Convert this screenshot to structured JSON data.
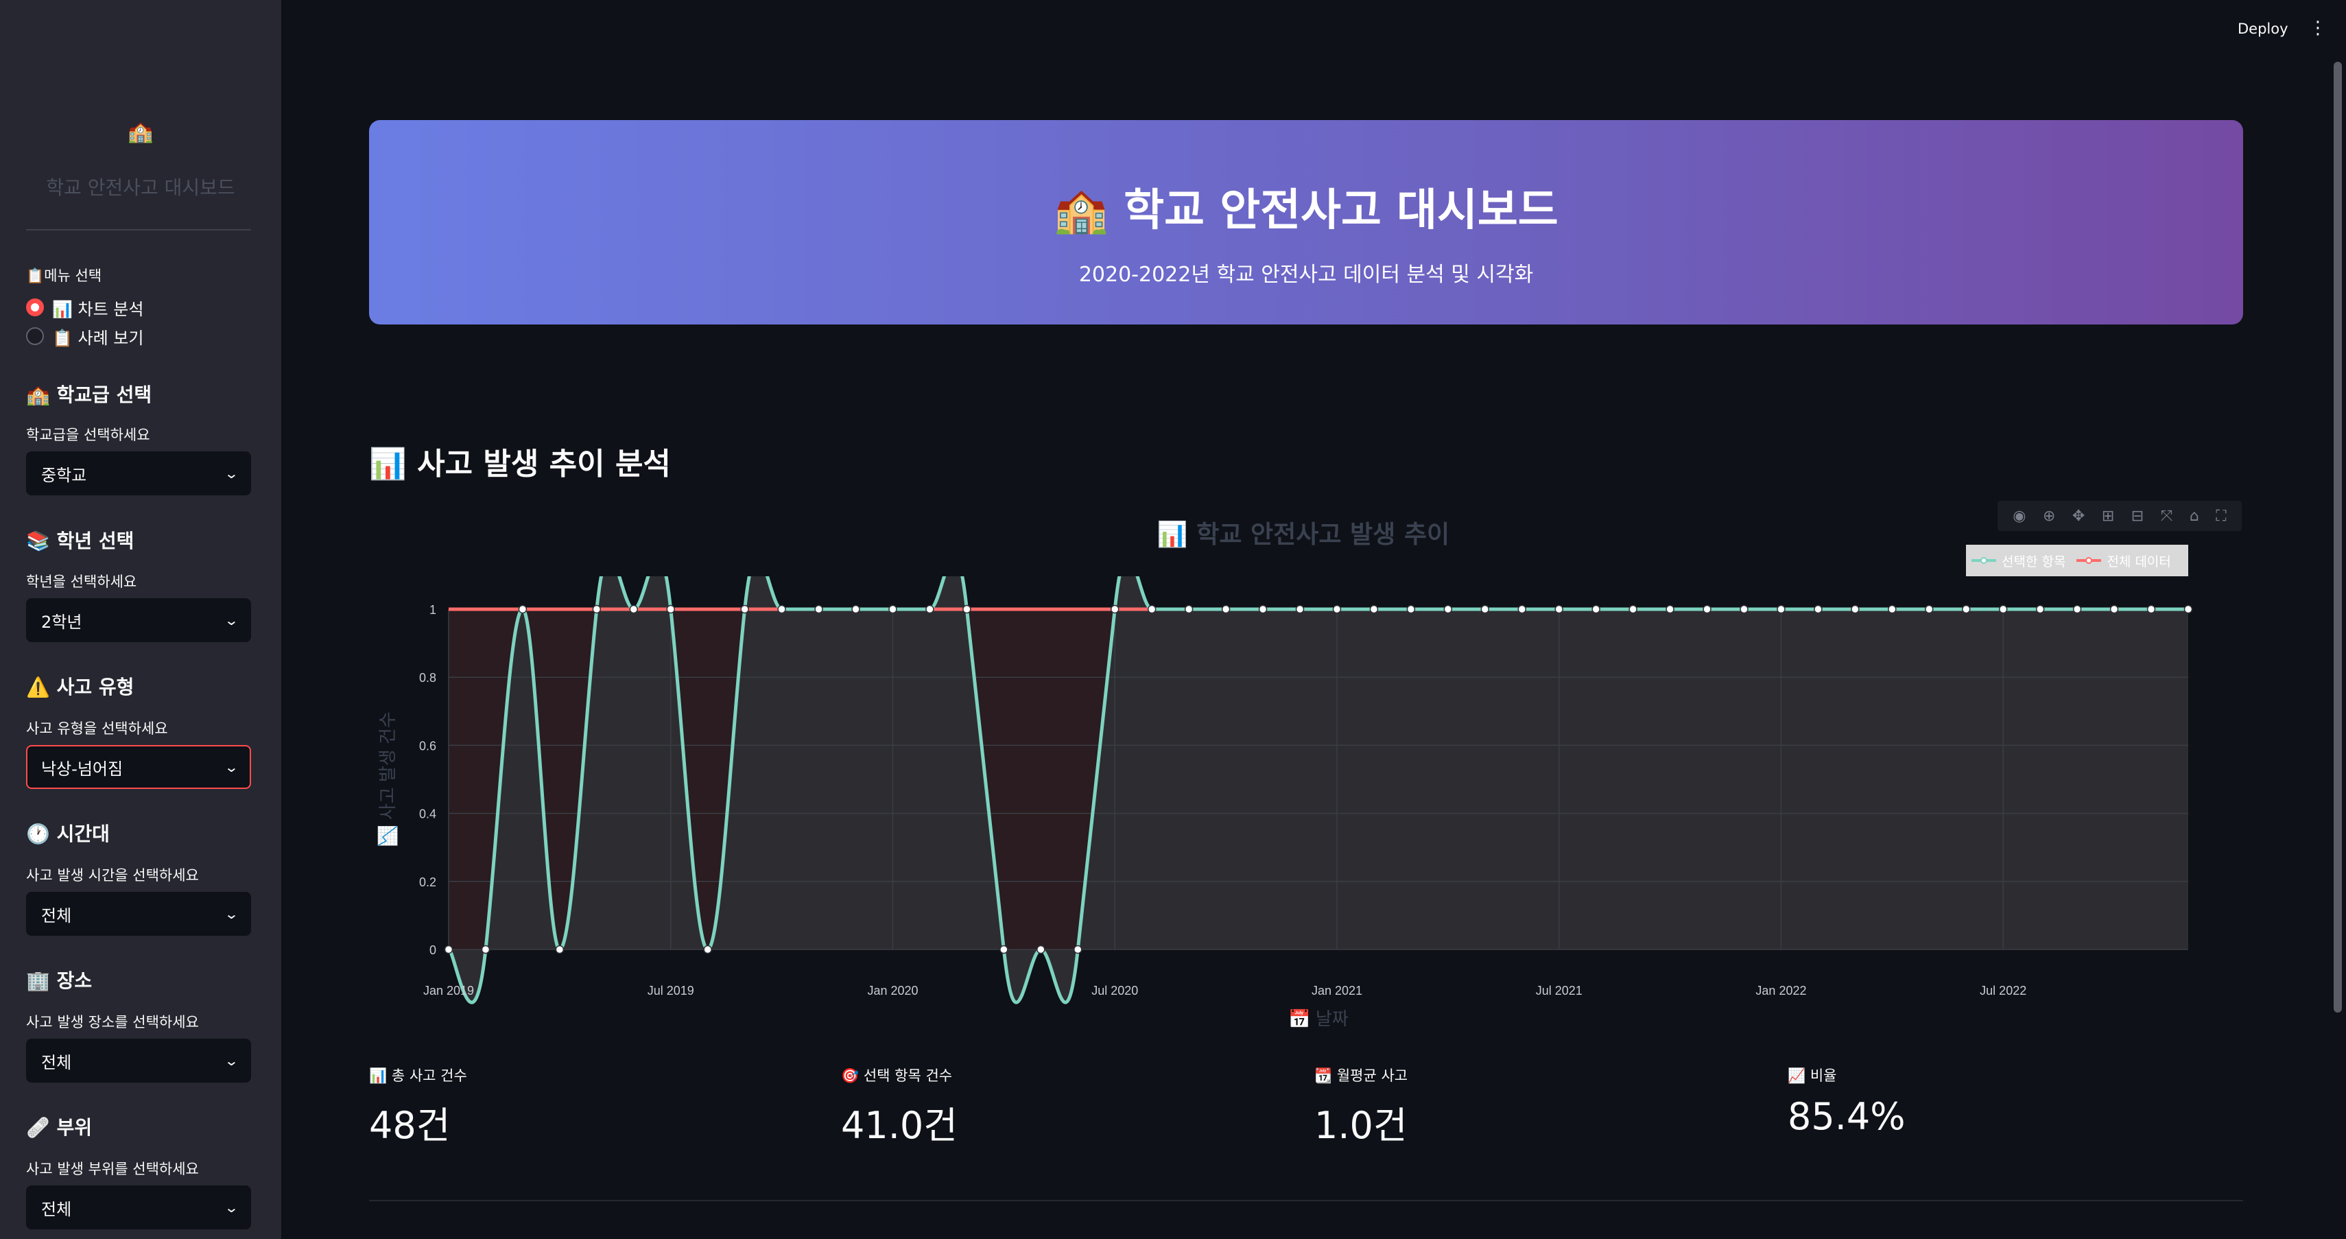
{
  "sidebar": {
    "logo": "🏫",
    "title": "학교 안전사고 대시보드",
    "menu_label": "📋메뉴 선택",
    "menu_options": [
      {
        "label": "📊 차트 분석",
        "selected": true
      },
      {
        "label": "📋 사례 보기",
        "selected": false
      }
    ],
    "filters": [
      {
        "heading": "🏫 학교급 선택",
        "label": "학교급을 선택하세요",
        "value": "중학교"
      },
      {
        "heading": "📚 학년 선택",
        "label": "학년을 선택하세요",
        "value": "2학년"
      },
      {
        "heading": "⚠️ 사고 유형",
        "label": "사고 유형을 선택하세요",
        "value": "낙상-넘어짐"
      },
      {
        "heading": "🕐 시간대",
        "label": "사고 발생 시간을 선택하세요",
        "value": "전체"
      },
      {
        "heading": "🏢 장소",
        "label": "사고 발생 장소를 선택하세요",
        "value": "전체"
      },
      {
        "heading": "🩹 부위",
        "label": "사고 발생 부위를 선택하세요",
        "value": "전체"
      }
    ]
  },
  "header": {
    "deploy_label": "Deploy",
    "more_icon": "kebab-menu-icon"
  },
  "hero": {
    "title": "🏫 학교 안전사고 대시보드",
    "subtitle": "2020-2022년 학교 안전사고 데이터 분석 및 시각화"
  },
  "section": {
    "title": "📊 사고 발생 추이 분석"
  },
  "modebar_icons": [
    "camera-icon",
    "zoom-icon",
    "pan-icon",
    "zoom-in-icon",
    "zoom-out-icon",
    "autoscale-icon",
    "home-icon",
    "fullscreen-icon"
  ],
  "chart_data": {
    "type": "line",
    "title": "📊 학교 안전사고 발생 추이",
    "xlabel": "📅 날짜",
    "ylabel": "📉 사고 발생 건수",
    "ylim": [
      0,
      1
    ],
    "yticks": [
      "0",
      "0.2",
      "0.4",
      "0.6",
      "0.8",
      "1"
    ],
    "xticks": [
      "Jan 2019",
      "Jul 2019",
      "Jan 2020",
      "Jul 2020",
      "Jan 2021",
      "Jul 2021",
      "Jan 2022",
      "Jul 2022"
    ],
    "x": [
      "2019-01",
      "2019-02",
      "2019-03",
      "2019-04",
      "2019-05",
      "2019-06",
      "2019-07",
      "2019-08",
      "2019-09",
      "2019-10",
      "2019-11",
      "2019-12",
      "2020-01",
      "2020-02",
      "2020-03",
      "2020-04",
      "2020-05",
      "2020-06",
      "2020-07",
      "2020-08",
      "2020-09",
      "2020-10",
      "2020-11",
      "2020-12",
      "2021-01",
      "2021-02",
      "2021-03",
      "2021-04",
      "2021-05",
      "2021-06",
      "2021-07",
      "2021-08",
      "2021-09",
      "2021-10",
      "2021-11",
      "2021-12",
      "2022-01",
      "2022-02",
      "2022-03",
      "2022-04",
      "2022-05",
      "2022-06",
      "2022-07",
      "2022-08",
      "2022-09",
      "2022-10",
      "2022-11",
      "2022-12"
    ],
    "series": [
      {
        "name": "선택한 항목",
        "color": "#7dd3c0",
        "values": [
          0,
          0,
          1,
          0,
          1,
          1,
          1,
          0,
          1,
          1,
          1,
          1,
          1,
          1,
          1,
          0,
          0,
          0,
          1,
          1,
          1,
          1,
          1,
          1,
          1,
          1,
          1,
          1,
          1,
          1,
          1,
          1,
          1,
          1,
          1,
          1,
          1,
          1,
          1,
          1,
          1,
          1,
          1,
          1,
          1,
          1,
          1,
          1
        ]
      },
      {
        "name": "전체 데이터",
        "color": "#ff6b6b",
        "values": [
          1,
          1,
          1,
          1,
          1,
          1,
          1,
          1,
          1,
          1,
          1,
          1,
          1,
          1,
          1,
          1,
          1,
          1,
          1,
          1,
          1,
          1,
          1,
          1,
          1,
          1,
          1,
          1,
          1,
          1,
          1,
          1,
          1,
          1,
          1,
          1,
          1,
          1,
          1,
          1,
          1,
          1,
          1,
          1,
          1,
          1,
          1,
          1
        ]
      }
    ],
    "legend_position": "top-right",
    "grid": true
  },
  "metrics": [
    {
      "label": "📊 총 사고 건수",
      "value": "48건"
    },
    {
      "label": "🎯 선택 항목 건수",
      "value": "41.0건"
    },
    {
      "label": "📆 월평균 사고",
      "value": "1.0건"
    },
    {
      "label": "📈 비율",
      "value": "85.4%"
    }
  ]
}
